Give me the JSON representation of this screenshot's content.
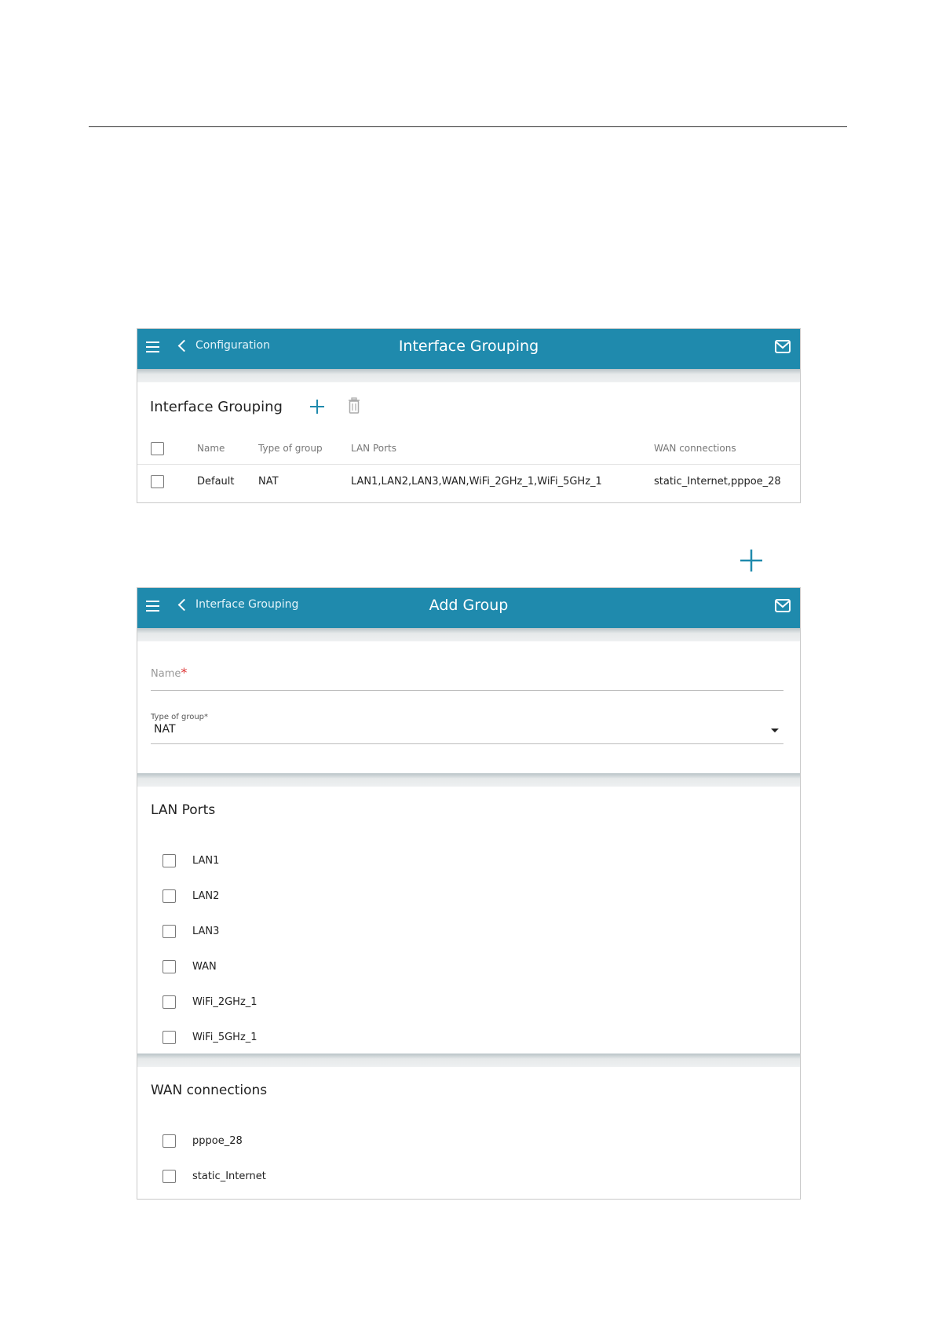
{
  "panel1": {
    "topbar": {
      "back_label": "Configuration",
      "title": "Interface Grouping"
    },
    "section_title": "Interface Grouping",
    "table": {
      "columns": [
        "Name",
        "Type of group",
        "LAN Ports",
        "WAN connections"
      ],
      "rows": [
        {
          "name": "Default",
          "type": "NAT",
          "lan_ports": "LAN1,LAN2,LAN3,WAN,WiFi_2GHz_1,WiFi_5GHz_1",
          "wan_connections": "static_Internet,pppoe_28"
        }
      ]
    }
  },
  "panel2": {
    "topbar": {
      "back_label": "Interface Grouping",
      "title": "Add Group"
    },
    "name_field": {
      "label": "Name",
      "value": ""
    },
    "type_field": {
      "label": "Type of group",
      "value": "NAT"
    },
    "required_mark": "*",
    "lan_section": {
      "title": "LAN Ports",
      "items": [
        "LAN1",
        "LAN2",
        "LAN3",
        "WAN",
        "WiFi_2GHz_1",
        "WiFi_5GHz_1"
      ]
    },
    "wan_section": {
      "title": "WAN connections",
      "items": [
        "pppoe_28",
        "static_Internet"
      ]
    }
  },
  "colors": {
    "topbar": "#1f8aad",
    "accent_icon": "#1f8aad"
  },
  "icons": [
    "menu-icon",
    "chevron-left-icon",
    "mail-icon",
    "plus-icon",
    "trash-icon",
    "caret-down-icon",
    "checkbox-icon"
  ]
}
